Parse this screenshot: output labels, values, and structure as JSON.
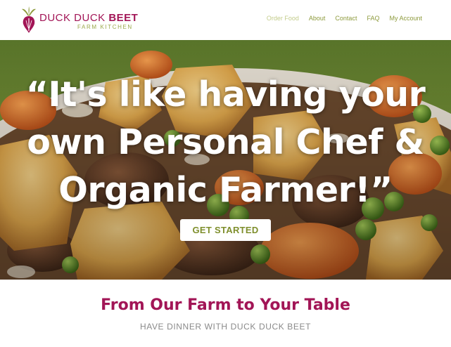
{
  "brand": {
    "name_light": "DUCK DUCK ",
    "name_bold": "BEET",
    "tagline": "FARM KITCHEN",
    "logo_icon": "beet-icon",
    "primary_color": "#a21556",
    "accent_color": "#8d9a3c"
  },
  "nav": {
    "items": [
      {
        "label": "Order Food",
        "active": true
      },
      {
        "label": "About"
      },
      {
        "label": "Contact"
      },
      {
        "label": "FAQ"
      },
      {
        "label": "My Account"
      }
    ]
  },
  "hero": {
    "quote": "“It's like having your own Personal Chef & Organic Farmer!”",
    "cta_label": "GET STARTED",
    "image": "roasted-vegetables-and-peas-photo"
  },
  "intro": {
    "title": "From Our Farm to Your Table",
    "subtitle": "HAVE DINNER WITH DUCK DUCK BEET"
  }
}
